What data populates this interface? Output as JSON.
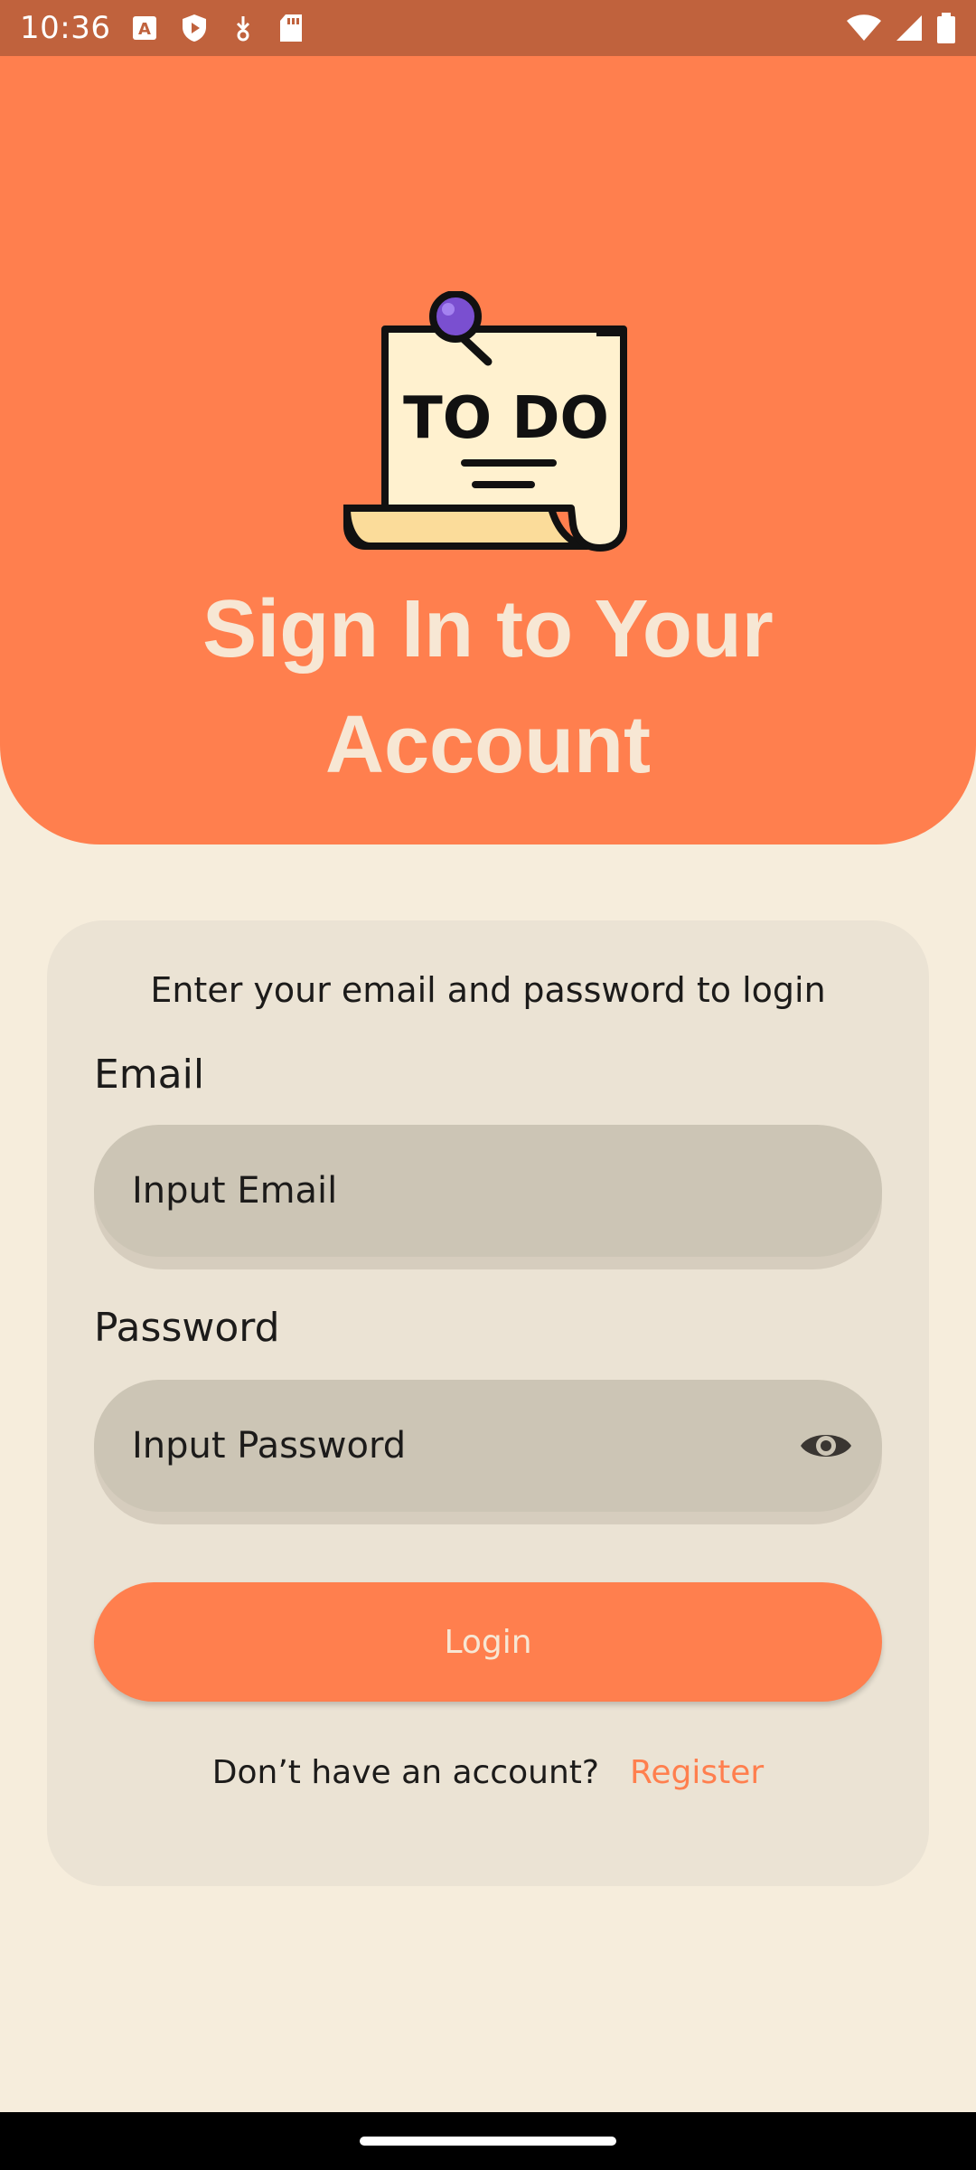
{
  "status_bar": {
    "time": "10:36",
    "icons_left": [
      "text-a-icon",
      "shield-play-icon",
      "download-icon",
      "sd-card-icon"
    ],
    "icons_right": [
      "wifi-icon",
      "signal-icon",
      "battery-icon"
    ]
  },
  "header": {
    "logo_text": "TO DO",
    "title_line1": "Sign In to Your",
    "title_line2": "Account"
  },
  "form": {
    "instructions": "Enter your email and password to login",
    "email_label": "Email",
    "email_placeholder": "Input Email",
    "password_label": "Password",
    "password_placeholder": "Input Password",
    "login_label": "Login",
    "no_account_text": "Don’t have an account?",
    "register_label": "Register"
  },
  "colors": {
    "accent": "#FF7F4E",
    "status_bar": "#C0623D",
    "background": "#F6EDDC",
    "card": "#EBE3D4",
    "input": "#CCC5B5"
  }
}
